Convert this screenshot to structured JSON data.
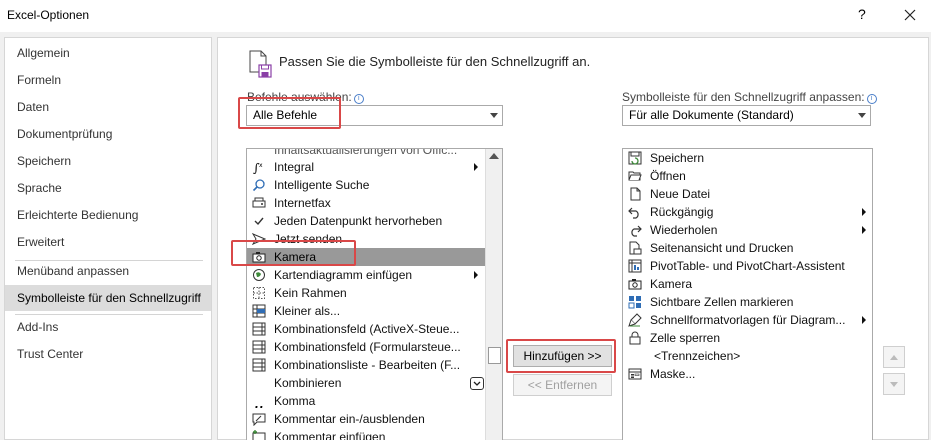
{
  "window": {
    "title": "Excel-Optionen",
    "help": "?"
  },
  "nav": {
    "items": [
      {
        "label": "Allgemein"
      },
      {
        "label": "Formeln"
      },
      {
        "label": "Daten"
      },
      {
        "label": "Dokumentprüfung"
      },
      {
        "label": "Speichern"
      },
      {
        "label": "Sprache"
      },
      {
        "label": "Erleichterte Bedienung"
      },
      {
        "label": "Erweitert"
      },
      {
        "label": "Menüband anpassen"
      },
      {
        "label": "Symbolleiste für den Schnellzugriff"
      },
      {
        "label": "Add-Ins"
      },
      {
        "label": "Trust Center"
      }
    ]
  },
  "header": {
    "text": "Passen Sie die Symbolleiste für den Schnellzugriff an."
  },
  "left": {
    "label": "Befehle auswählen:",
    "combo_value": "Alle Befehle",
    "items": [
      {
        "label": "Inhaltsaktualisierungen von Offic...",
        "icon": "blank-icon"
      },
      {
        "label": "Integral",
        "icon": "integral-icon",
        "submenu": true
      },
      {
        "label": "Intelligente Suche",
        "icon": "search-icon"
      },
      {
        "label": "Internetfax",
        "icon": "fax-icon"
      },
      {
        "label": "Jeden Datenpunkt hervorheben",
        "icon": "check-icon"
      },
      {
        "label": "Jetzt senden",
        "icon": "send-icon"
      },
      {
        "label": "Kamera",
        "icon": "camera-icon"
      },
      {
        "label": "Kartendiagramm einfügen",
        "icon": "map-chart-icon",
        "submenu": true
      },
      {
        "label": "Kein Rahmen",
        "icon": "no-border-icon"
      },
      {
        "label": "Kleiner als...",
        "icon": "less-than-icon"
      },
      {
        "label": "Kombinationsfeld (ActiveX-Steue...",
        "icon": "combobox-icon"
      },
      {
        "label": "Kombinationsfeld (Formularsteue...",
        "icon": "combobox-icon"
      },
      {
        "label": "Kombinationsliste - Bearbeiten (F...",
        "icon": "combobox-icon"
      },
      {
        "label": "Kombinieren",
        "icon": "blank-icon",
        "dropdown": true
      },
      {
        "label": "Komma",
        "icon": "comma-icon"
      },
      {
        "label": "Kommentar ein-/ausblenden",
        "icon": "comment-icon"
      },
      {
        "label": "Kommentar einfügen",
        "icon": "new-comment-icon"
      }
    ]
  },
  "buttons": {
    "add": "Hinzufügen >>",
    "remove": "<< Entfernen"
  },
  "right": {
    "label": "Symbolleiste für den Schnellzugriff anpassen:",
    "combo_value": "Für alle Dokumente (Standard)",
    "items": [
      {
        "label": "Speichern",
        "icon": "save-icon"
      },
      {
        "label": "Öffnen",
        "icon": "open-folder-icon"
      },
      {
        "label": "Neue Datei",
        "icon": "new-file-icon"
      },
      {
        "label": "Rückgängig",
        "icon": "undo-icon",
        "submenu": true
      },
      {
        "label": "Wiederholen",
        "icon": "redo-icon",
        "submenu": true
      },
      {
        "label": "Seitenansicht und Drucken",
        "icon": "print-preview-icon"
      },
      {
        "label": "PivotTable- und PivotChart-Assistent",
        "icon": "pivot-icon"
      },
      {
        "label": "Kamera",
        "icon": "camera-icon"
      },
      {
        "label": "Sichtbare Zellen markieren",
        "icon": "grid-icon"
      },
      {
        "label": "Schnellformatvorlagen für Diagram...",
        "icon": "brush-icon",
        "submenu": true
      },
      {
        "label": "Zelle sperren",
        "icon": "lock-icon"
      },
      {
        "label": "<Trennzeichen>",
        "icon": "none"
      },
      {
        "label": "Maske...",
        "icon": "form-icon"
      }
    ]
  },
  "colors": {
    "highlight": "#d94848",
    "selection": "#999999",
    "accent": "#4a7ec9"
  }
}
